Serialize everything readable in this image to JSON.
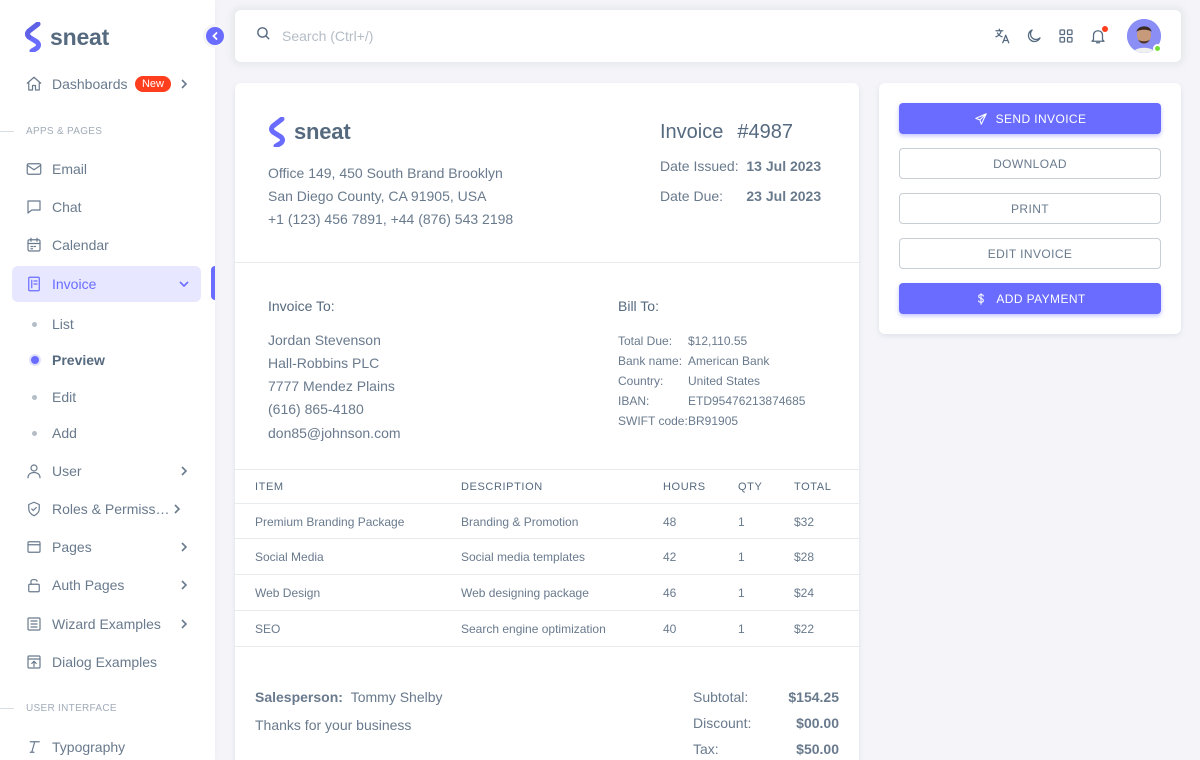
{
  "app": {
    "brand": "sneat"
  },
  "colors": {
    "primary": "#696cff",
    "danger": "#ff3e1d",
    "success": "#71dd37"
  },
  "sidebar": {
    "dashboards": {
      "label": "Dashboards",
      "badge": "New",
      "icon": "home-icon"
    },
    "header_apps": "APPS & PAGES",
    "items": [
      {
        "label": "Email",
        "icon": "mail-icon"
      },
      {
        "label": "Chat",
        "icon": "chat-icon"
      },
      {
        "label": "Calendar",
        "icon": "calendar-icon"
      },
      {
        "label": "Invoice",
        "icon": "invoice-icon"
      }
    ],
    "invoice_sub": [
      {
        "label": "List"
      },
      {
        "label": "Preview"
      },
      {
        "label": "Edit"
      },
      {
        "label": "Add"
      }
    ],
    "items2": [
      {
        "label": "User",
        "icon": "user-icon"
      },
      {
        "label": "Roles & Permissions",
        "icon": "shield-icon"
      },
      {
        "label": "Pages",
        "icon": "pages-icon"
      },
      {
        "label": "Auth Pages",
        "icon": "lock-icon"
      },
      {
        "label": "Wizard Examples",
        "icon": "wizard-icon"
      },
      {
        "label": "Dialog Examples",
        "icon": "dialog-icon"
      }
    ],
    "header_ui": "USER INTERFACE",
    "typography": {
      "label": "Typography",
      "icon": "typography-icon"
    }
  },
  "navbar": {
    "search_placeholder": "Search (Ctrl+/)"
  },
  "invoice": {
    "brand": "sneat",
    "address": [
      "Office 149, 450 South Brand Brooklyn",
      "San Diego County, CA 91905, USA",
      "+1 (123) 456 7891, +44 (876) 543 2198"
    ],
    "title": "Invoice",
    "number": "#4987",
    "date_issued_label": "Date Issued:",
    "date_issued": "13 Jul 2023",
    "date_due_label": "Date Due:",
    "date_due": "23 Jul 2023",
    "to_title": "Invoice To:",
    "to": [
      "Jordan Stevenson",
      "Hall-Robbins PLC",
      "7777 Mendez Plains",
      "(616) 865-4180",
      "don85@johnson.com"
    ],
    "bill_title": "Bill To:",
    "bill": [
      {
        "label": "Total Due:",
        "value": "$12,110.55"
      },
      {
        "label": "Bank name:",
        "value": "American Bank"
      },
      {
        "label": "Country:",
        "value": "United States"
      },
      {
        "label": "IBAN:",
        "value": "ETD95476213874685"
      },
      {
        "label": "SWIFT code:",
        "value": "BR91905"
      }
    ],
    "columns": [
      "ITEM",
      "DESCRIPTION",
      "HOURS",
      "QTY",
      "TOTAL"
    ],
    "rows": [
      [
        "Premium Branding Package",
        "Branding & Promotion",
        "48",
        "1",
        "$32"
      ],
      [
        "Social Media",
        "Social media templates",
        "42",
        "1",
        "$28"
      ],
      [
        "Web Design",
        "Web designing package",
        "46",
        "1",
        "$24"
      ],
      [
        "SEO",
        "Search engine optimization",
        "40",
        "1",
        "$22"
      ]
    ],
    "salesperson_label": "Salesperson:",
    "salesperson": "Tommy Shelby",
    "thanks": "Thanks for your business",
    "summary": [
      {
        "label": "Subtotal:",
        "value": "$154.25"
      },
      {
        "label": "Discount:",
        "value": "$00.00"
      },
      {
        "label": "Tax:",
        "value": "$50.00"
      }
    ]
  },
  "actions": {
    "send": "SEND INVOICE",
    "download": "DOWNLOAD",
    "print": "PRINT",
    "edit": "EDIT INVOICE",
    "add_payment": "ADD PAYMENT"
  }
}
